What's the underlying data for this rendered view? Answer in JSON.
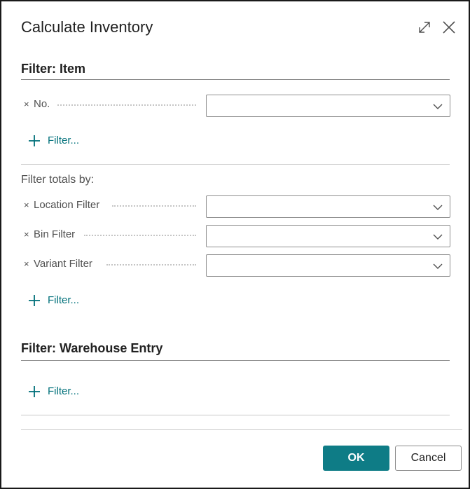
{
  "dialog": {
    "title": "Calculate Inventory",
    "icons": {
      "expand": "expand-icon",
      "close": "close-icon"
    }
  },
  "item_section": {
    "title": "Filter: Item",
    "fields": [
      {
        "remove": "×",
        "label": "No.",
        "value": ""
      }
    ],
    "add_filter_label": "Filter..."
  },
  "totals_section": {
    "title": "Filter totals by:",
    "fields": [
      {
        "remove": "×",
        "label": "Location Filter",
        "value": ""
      },
      {
        "remove": "×",
        "label": "Bin Filter",
        "value": ""
      },
      {
        "remove": "×",
        "label": "Variant Filter",
        "value": ""
      }
    ],
    "add_filter_label": "Filter..."
  },
  "warehouse_section": {
    "title": "Filter: Warehouse Entry",
    "add_filter_label": "Filter..."
  },
  "buttons": {
    "ok": "OK",
    "cancel": "Cancel"
  },
  "colors": {
    "accent": "#0e7c86",
    "link": "#00707a"
  }
}
